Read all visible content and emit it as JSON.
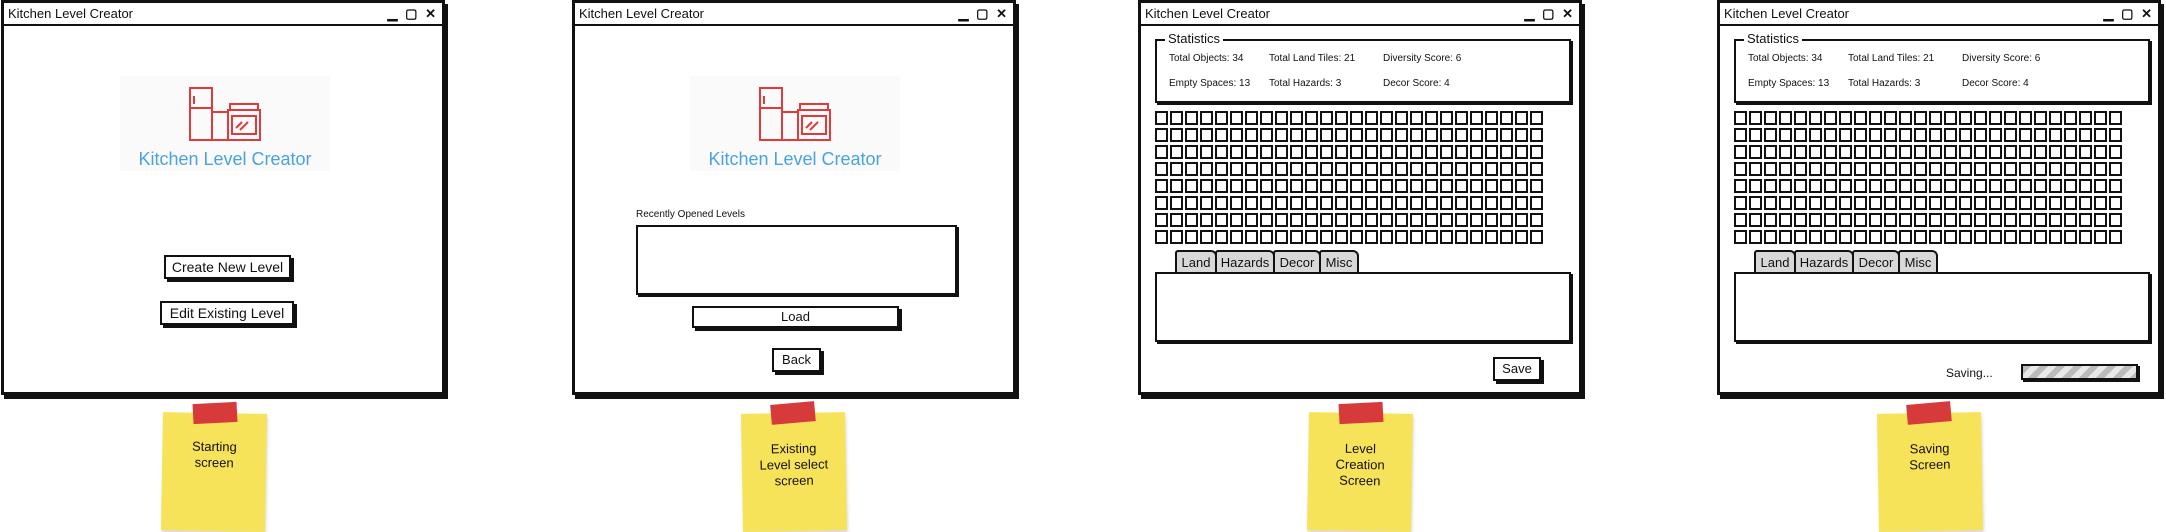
{
  "app_title": "Kitchen Level Creator",
  "window_controls": {
    "minimize": "▁",
    "maximize": "▢",
    "close": "✕"
  },
  "logo_text": "Kitchen Level Creator",
  "screen1": {
    "create_button": "Create New Level",
    "edit_button": "Edit Existing Level",
    "note": "Starting screen"
  },
  "screen2": {
    "recent_label": "Recently Opened Levels",
    "load_button": "Load",
    "back_button": "Back",
    "note": "Existing Level select screen"
  },
  "stats": {
    "title": "Statistics",
    "total_objects": "Total Objects: 34",
    "total_land_tiles": "Total Land Tiles: 21",
    "diversity_score": "Diversity Score: 6",
    "empty_spaces": "Empty Spaces: 13",
    "total_hazards": "Total Hazards: 3",
    "decor_score": "Decor Score: 4"
  },
  "tabs": [
    "Land",
    "Hazards",
    "Decor",
    "Misc"
  ],
  "screen3": {
    "save_button": "Save",
    "note": "Level Creation Screen"
  },
  "screen4": {
    "saving_label": "Saving...",
    "progress": 1.0,
    "note": "Saving Screen"
  },
  "colors": {
    "note": "#f7e35a",
    "tape": "#d63a3a",
    "logo_accent": "#4aa3df",
    "logo_line": "#e03a3a"
  }
}
